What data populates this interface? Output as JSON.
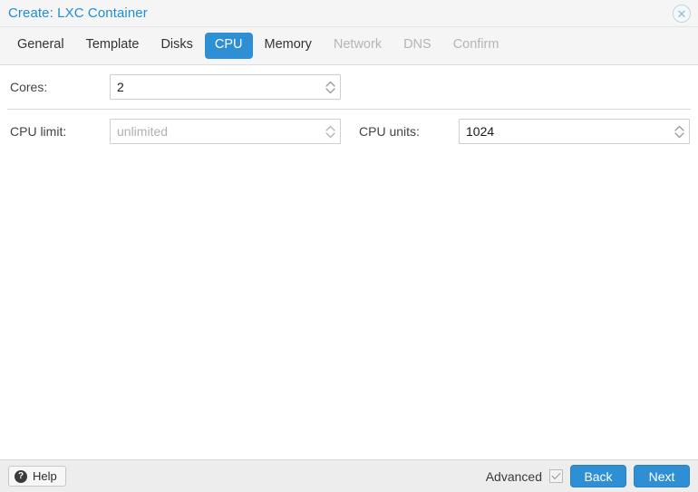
{
  "window": {
    "title": "Create: LXC Container",
    "close_icon": "close-circle-icon"
  },
  "tabs": [
    {
      "label": "General",
      "state": "enabled"
    },
    {
      "label": "Template",
      "state": "enabled"
    },
    {
      "label": "Disks",
      "state": "enabled"
    },
    {
      "label": "CPU",
      "state": "active"
    },
    {
      "label": "Memory",
      "state": "enabled"
    },
    {
      "label": "Network",
      "state": "disabled"
    },
    {
      "label": "DNS",
      "state": "disabled"
    },
    {
      "label": "Confirm",
      "state": "disabled"
    }
  ],
  "form": {
    "cores": {
      "label": "Cores:",
      "value": "2",
      "placeholder": ""
    },
    "cpu_limit": {
      "label": "CPU limit:",
      "value": "",
      "placeholder": "unlimited"
    },
    "cpu_units": {
      "label": "CPU units:",
      "value": "1024",
      "placeholder": ""
    }
  },
  "footer": {
    "help_label": "Help",
    "help_icon": "question-mark-icon",
    "advanced_label": "Advanced",
    "advanced_checked": true,
    "back_label": "Back",
    "next_label": "Next"
  },
  "colors": {
    "accent_blue": "#2f8fd4",
    "title_blue": "#1f8dd6",
    "disabled_gray": "#b5b5b5"
  }
}
